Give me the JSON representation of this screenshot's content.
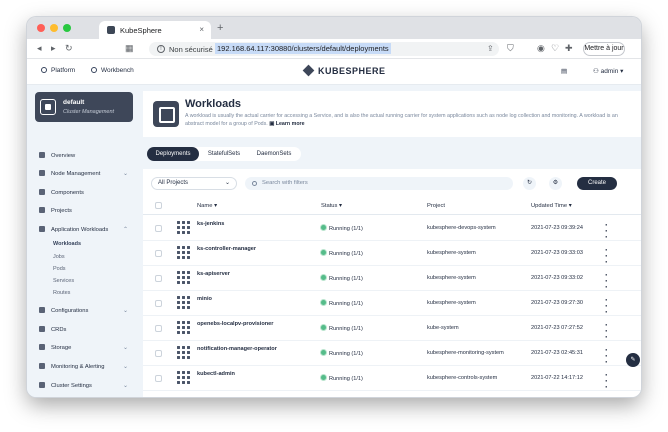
{
  "browser": {
    "tab_title": "KubeSphere",
    "tab_close": "×",
    "new_tab": "+",
    "security_label": "Non sécurisé",
    "url": "192.168.64.117:30880/clusters/default/deployments",
    "update_button": "Mettre à jour",
    "nav_icons": [
      "back-arrow",
      "forward-arrow",
      "reload"
    ]
  },
  "header": {
    "platform": "Platform",
    "workbench": "Workbench",
    "logo": "KUBESPHERE",
    "user": "admin"
  },
  "sidebar": {
    "cluster_name": "default",
    "cluster_subtitle": "Cluster Management",
    "items": [
      {
        "label": "Overview",
        "chevron": ""
      },
      {
        "label": "Node Management",
        "chevron": "⌄"
      },
      {
        "label": "Components",
        "chevron": ""
      },
      {
        "label": "Projects",
        "chevron": ""
      },
      {
        "label": "Application Workloads",
        "chevron": "⌃"
      },
      {
        "label": "Configurations",
        "chevron": "⌄"
      },
      {
        "label": "CRDs",
        "chevron": ""
      },
      {
        "label": "Storage",
        "chevron": "⌄"
      },
      {
        "label": "Monitoring & Alerting",
        "chevron": "⌄"
      },
      {
        "label": "Cluster Settings",
        "chevron": "⌄"
      }
    ],
    "subitems": [
      "Workloads",
      "Jobs",
      "Pods",
      "Services",
      "Routes"
    ]
  },
  "banner": {
    "title": "Workloads",
    "description": "A workload is usually the actual carrier for accessing a Service, and is also the actual running carrier for system applications such as node log collection and monitoring. A workload is an abstract model for a group of Pods.",
    "learn_more": "Learn more"
  },
  "tabs": [
    "Deployments",
    "StatefulSets",
    "DaemonSets"
  ],
  "filters": {
    "project_select": "All Projects",
    "search_placeholder": "Search with filters",
    "create": "Create"
  },
  "table": {
    "columns": [
      "Name",
      "Status",
      "Project",
      "Updated Time"
    ],
    "rows": [
      {
        "name": "ks-jenkins",
        "status": "Running (1/1)",
        "project": "kubesphere-devops-system",
        "updated": "2021-07-23 09:39:24"
      },
      {
        "name": "ks-controller-manager",
        "status": "Running (1/1)",
        "project": "kubesphere-system",
        "updated": "2021-07-23 09:33:03"
      },
      {
        "name": "ks-apiserver",
        "status": "Running (1/1)",
        "project": "kubesphere-system",
        "updated": "2021-07-23 09:33:02"
      },
      {
        "name": "minio",
        "status": "Running (1/1)",
        "project": "kubesphere-system",
        "updated": "2021-07-23 09:27:30"
      },
      {
        "name": "openebs-localpv-provisioner",
        "status": "Running (1/1)",
        "project": "kube-system",
        "updated": "2021-07-23 07:27:52"
      },
      {
        "name": "notification-manager-operator",
        "status": "Running (1/1)",
        "project": "kubesphere-monitoring-system",
        "updated": "2021-07-23 02:45:31"
      },
      {
        "name": "kubectl-admin",
        "status": "Running (1/1)",
        "project": "kubesphere-controls-system",
        "updated": "2021-07-22 14:17:12"
      }
    ]
  },
  "colors": {
    "primary": "#242e42",
    "sidebar_bg": "#eff4f9",
    "running": "#55bc8a"
  }
}
